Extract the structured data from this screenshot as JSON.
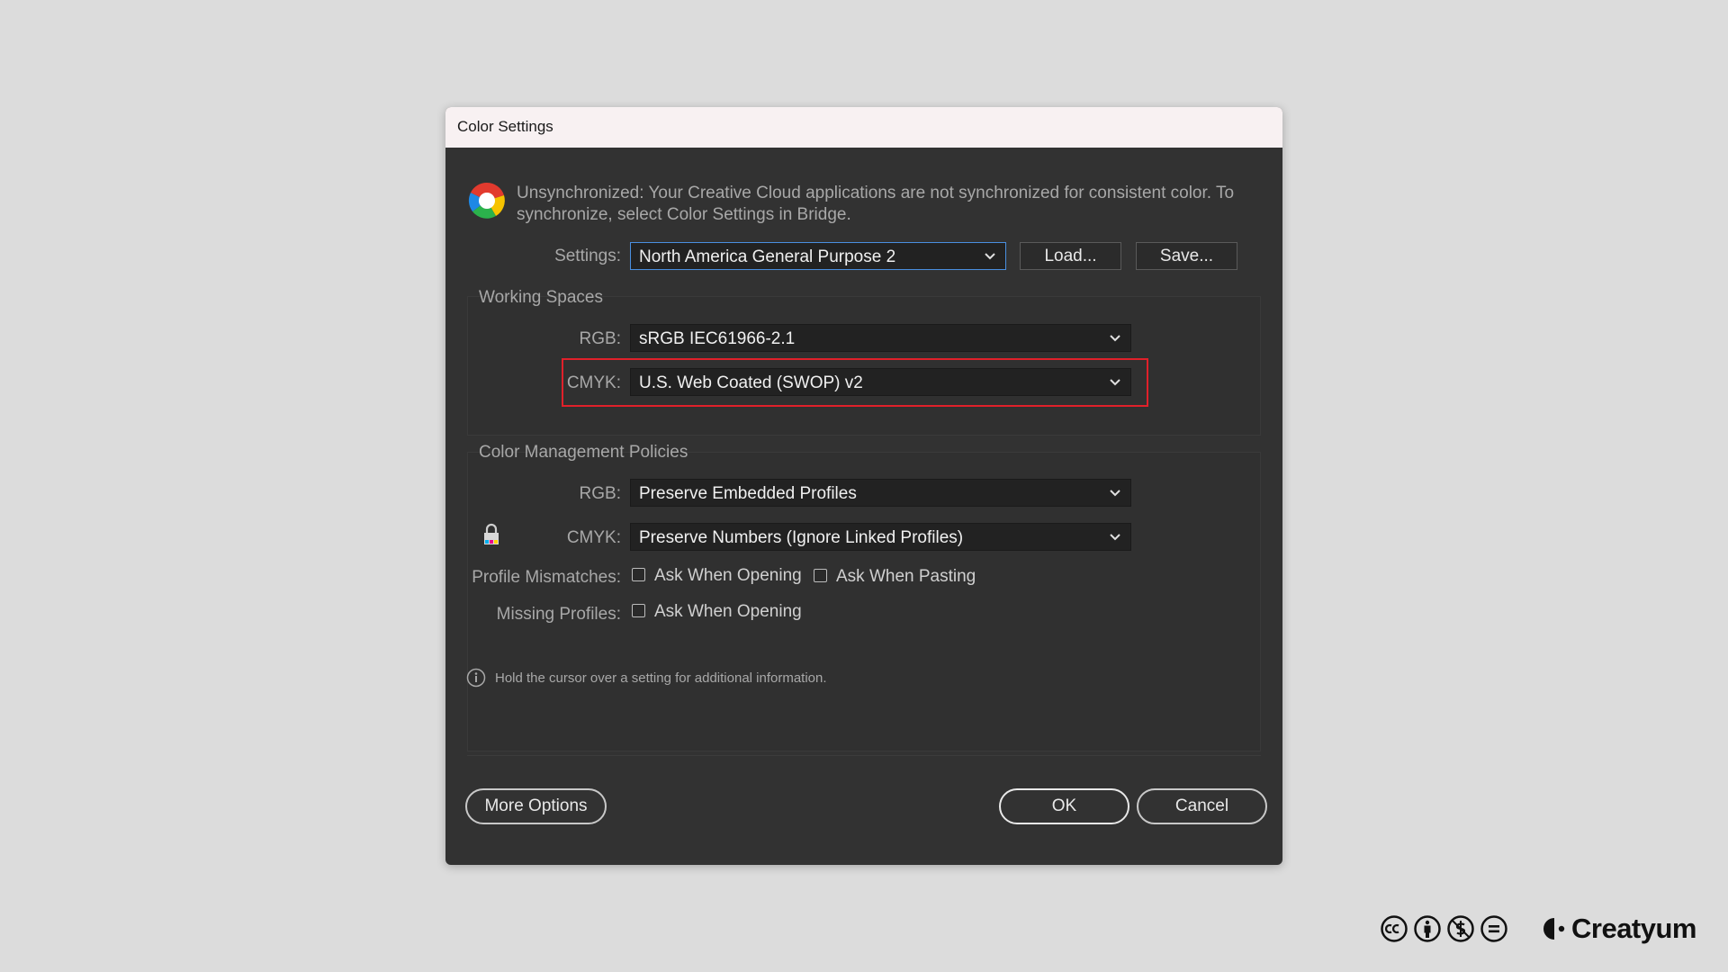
{
  "window": {
    "title": "Color Settings"
  },
  "sync_message": "Unsynchronized: Your Creative Cloud applications are not synchronized for consistent color. To synchronize, select Color Settings in Bridge.",
  "settings": {
    "label": "Settings:",
    "value": "North America General Purpose 2",
    "load_label": "Load...",
    "save_label": "Save..."
  },
  "working_spaces": {
    "heading": "Working Spaces",
    "rgb_label": "RGB:",
    "rgb_value": "sRGB IEC61966-2.1",
    "cmyk_label": "CMYK:",
    "cmyk_value": "U.S. Web Coated (SWOP) v2"
  },
  "policies": {
    "heading": "Color Management Policies",
    "rgb_label": "RGB:",
    "rgb_value": "Preserve Embedded Profiles",
    "cmyk_label": "CMYK:",
    "cmyk_value": "Preserve Numbers (Ignore Linked Profiles)",
    "mismatch_label": "Profile Mismatches:",
    "ask_opening": "Ask When Opening",
    "ask_pasting": "Ask When Pasting",
    "missing_label": "Missing Profiles:",
    "missing_ask_opening": "Ask When Opening"
  },
  "info_text": "Hold the cursor over a setting for additional information.",
  "buttons": {
    "more_options": "More Options",
    "ok": "OK",
    "cancel": "Cancel"
  },
  "footer": {
    "brand": "Creatyum",
    "icons": [
      "cc-icon",
      "attribution-icon",
      "noncommercial-icon",
      "noderivatives-icon"
    ]
  },
  "colors": {
    "highlight": "#e0202a",
    "dialog_bg": "#323232",
    "focus": "#4a8fe0"
  }
}
